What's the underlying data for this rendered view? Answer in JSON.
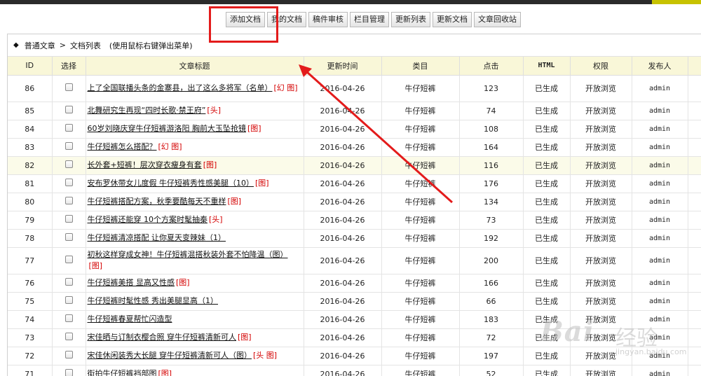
{
  "toolbar": {
    "buttons": [
      "添加文档",
      "我的文档",
      "稿件审核",
      "栏目管理",
      "更新列表",
      "更新文档",
      "文章回收站"
    ]
  },
  "breadcrumb": {
    "root": "普通文章",
    "separator": ">",
    "current": "文档列表",
    "hint": "(使用鼠标右键弹出菜单)"
  },
  "table": {
    "headers": {
      "id": "ID",
      "select": "选择",
      "title": "文章标题",
      "updated": "更新时间",
      "category": "类目",
      "clicks": "点击",
      "html": "HTML",
      "permission": "权限",
      "publisher": "发布人"
    },
    "rows": [
      {
        "id": "86",
        "title": "上了全国联播头条的金寨县，出了这么多将军（名单）",
        "flags": "[幻 图]",
        "date": "2016-04-26",
        "category": "牛仔短裤",
        "clicks": "123",
        "html": "已生成",
        "perm": "开放浏览",
        "user": "admin"
      },
      {
        "id": "85",
        "title": "北舞研究生再现“四时长歌·禁王府”",
        "flags": "[头]",
        "date": "2016-04-26",
        "category": "牛仔短裤",
        "clicks": "74",
        "html": "已生成",
        "perm": "开放浏览",
        "user": "admin"
      },
      {
        "id": "84",
        "title": "60岁刘晓庆穿牛仔短裤游洛阳 胸前大玉坠抢镜",
        "flags": "[图]",
        "date": "2016-04-26",
        "category": "牛仔短裤",
        "clicks": "108",
        "html": "已生成",
        "perm": "开放浏览",
        "user": "admin"
      },
      {
        "id": "83",
        "title": "牛仔短裤怎么搭配？",
        "flags": "[幻 图]",
        "date": "2016-04-26",
        "category": "牛仔短裤",
        "clicks": "164",
        "html": "已生成",
        "perm": "开放浏览",
        "user": "admin"
      },
      {
        "id": "82",
        "title": "长外套+短裤！层次穿衣瘦身有套",
        "flags": "[图]",
        "date": "2016-04-26",
        "category": "牛仔短裤",
        "clicks": "116",
        "html": "已生成",
        "perm": "开放浏览",
        "user": "admin"
      },
      {
        "id": "81",
        "title": "安布罗休带女儿度假 牛仔短裤秀性感美腿（10）",
        "flags": "[图]",
        "date": "2016-04-26",
        "category": "牛仔短裤",
        "clicks": "176",
        "html": "已生成",
        "perm": "开放浏览",
        "user": "admin"
      },
      {
        "id": "80",
        "title": "牛仔短裤搭配方案，秋季要酷每天不重样",
        "flags": "[图]",
        "date": "2016-04-26",
        "category": "牛仔短裤",
        "clicks": "134",
        "html": "已生成",
        "perm": "开放浏览",
        "user": "admin"
      },
      {
        "id": "79",
        "title": "牛仔短裤还能穿 10个方案时髦抽秦",
        "flags": "[头]",
        "date": "2016-04-26",
        "category": "牛仔短裤",
        "clicks": "73",
        "html": "已生成",
        "perm": "开放浏览",
        "user": "admin"
      },
      {
        "id": "78",
        "title": "牛仔短裤清凉搭配 让你夏天变辣妹（1）",
        "flags": "",
        "date": "2016-04-26",
        "category": "牛仔短裤",
        "clicks": "192",
        "html": "已生成",
        "perm": "开放浏览",
        "user": "admin"
      },
      {
        "id": "77",
        "title": "初秋这样穿成女神！牛仔短裤混搭秋装外套不怕降温（图）",
        "flags": "[图]",
        "date": "2016-04-26",
        "category": "牛仔短裤",
        "clicks": "200",
        "html": "已生成",
        "perm": "开放浏览",
        "user": "admin"
      },
      {
        "id": "76",
        "title": "牛仔短裤美搭 显高又性感",
        "flags": "[图]",
        "date": "2016-04-26",
        "category": "牛仔短裤",
        "clicks": "166",
        "html": "已生成",
        "perm": "开放浏览",
        "user": "admin"
      },
      {
        "id": "75",
        "title": "牛仔短裤时髦性感 秀出美腿显高（1）",
        "flags": "",
        "date": "2016-04-26",
        "category": "牛仔短裤",
        "clicks": "66",
        "html": "已生成",
        "perm": "开放浏览",
        "user": "admin"
      },
      {
        "id": "74",
        "title": "牛仔短裤春夏帮忙闪造型",
        "flags": "",
        "date": "2016-04-26",
        "category": "牛仔短裤",
        "clicks": "183",
        "html": "已生成",
        "perm": "开放浏览",
        "user": "admin"
      },
      {
        "id": "73",
        "title": "宋佳晒与订制衣樱合照 穿牛仔短裤清新可人",
        "flags": "[图]",
        "date": "2016-04-26",
        "category": "牛仔短裤",
        "clicks": "72",
        "html": "已生成",
        "perm": "开放浏览",
        "user": "admin"
      },
      {
        "id": "72",
        "title": "宋佳休闲装秀大长腿 穿牛仔短裤清新可人（图）",
        "flags": "[头 图]",
        "date": "2016-04-26",
        "category": "牛仔短裤",
        "clicks": "197",
        "html": "已生成",
        "perm": "开放浏览",
        "user": "admin"
      },
      {
        "id": "71",
        "title": "街拍牛仔短裤裆部图",
        "flags": "[图]",
        "date": "2016-04-26",
        "category": "牛仔短裤",
        "clicks": "52",
        "html": "已生成",
        "perm": "开放浏览",
        "user": "admin"
      }
    ]
  },
  "annotation": {
    "box_color": "#e31b1b",
    "arrow_color": "#e31b1b"
  },
  "watermark": {
    "logo": "Bai",
    "sub": "经验",
    "url": "jingyan.baidu.com"
  }
}
